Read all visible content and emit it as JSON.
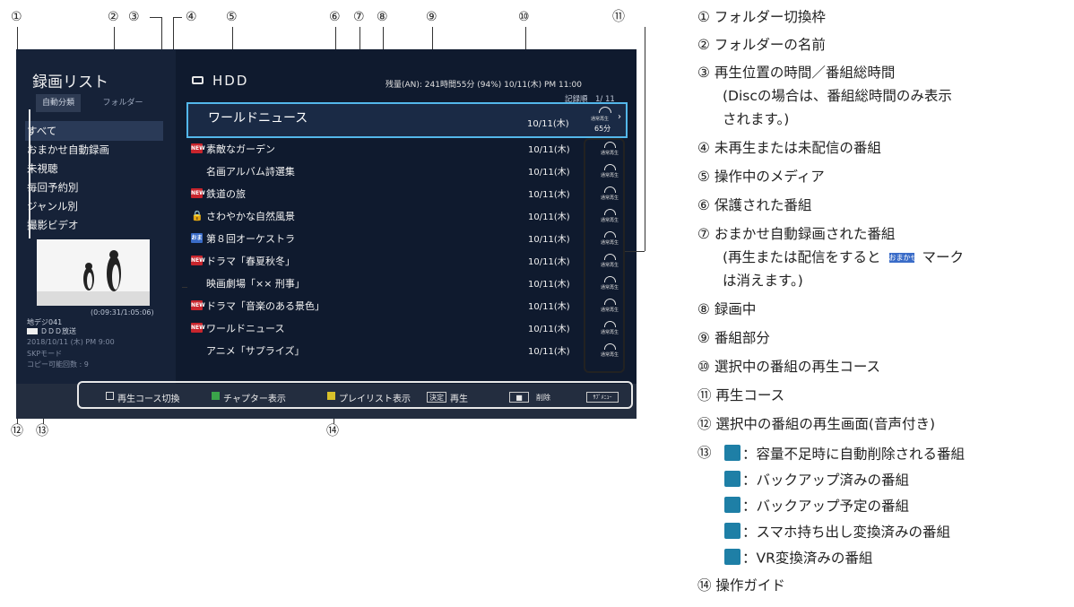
{
  "callouts": [
    "①",
    "②",
    "③",
    "④",
    "⑤",
    "⑥",
    "⑦",
    "⑧",
    "⑨",
    "⑩",
    "⑪",
    "⑫",
    "⑬",
    "⑭"
  ],
  "screen": {
    "left_panel": {
      "title": "録画リスト",
      "tabs": [
        "自動分類",
        "フォルダー"
      ],
      "folders": [
        "すべて",
        "おまかせ自動録画",
        "未視聴",
        "毎回予約別",
        "ジャンル別",
        "撮影ビデオ"
      ],
      "time_code": "(0:09:31/1:05:06)",
      "channel": "地デジ041",
      "broadcaster": "ＤＤＤ放送",
      "air_time": "2018/10/11 (木) PM 9:00",
      "mode": "SKPモード",
      "copy_count": "コピー可能回数 : 9",
      "trash_glyph": "⊞"
    },
    "header": {
      "media": "HDD",
      "remaining": "残量(AN):  241時間55分 (94%)  10/11(木)  PM 11:00",
      "sort": "記録順　1/ 11"
    },
    "selected": {
      "title": "ワールドニュース",
      "date": "10/11(木)",
      "course": "通常再生",
      "minutes": "65分",
      "arrow": "›"
    },
    "programs": [
      {
        "badge": "NEW",
        "title": "素敵なガーデン",
        "date": "10/11(木)",
        "course": "通常再生"
      },
      {
        "badge": "",
        "title": "名画アルバム詩選集",
        "date": "10/11(木)",
        "course": "通常再生"
      },
      {
        "badge": "NEW",
        "title": "鉄道の旅",
        "date": "10/11(木)",
        "course": "通常再生"
      },
      {
        "badge": "🔒",
        "title": "さわやかな自然風景",
        "date": "10/11(木)",
        "course": "通常再生"
      },
      {
        "badge": "おま",
        "title": "第８回オーケストラ",
        "date": "10/11(木)",
        "course": "通常再生"
      },
      {
        "badge": "NEW",
        "title": "ドラマ「春夏秋冬」",
        "date": "10/11(木)",
        "course": "通常再生"
      },
      {
        "badge": "",
        "title": "映画劇場「×× 刑事」",
        "date": "10/11(木)",
        "course": "通常再生"
      },
      {
        "badge": "NEW",
        "title": "ドラマ「音楽のある景色」",
        "date": "10/11(木)",
        "course": "通常再生"
      },
      {
        "badge": "NEW",
        "title": "ワールドニュース",
        "date": "10/11(木)",
        "course": "通常再生"
      },
      {
        "badge": "",
        "title": "アニメ「サプライズ」",
        "date": "10/11(木)",
        "course": "通常再生"
      }
    ],
    "guide": {
      "switch": "再生コース切換",
      "chapter": "チャプター表示",
      "playlist": "プレイリスト表示",
      "enter_key": "決定",
      "play": "再生",
      "delete": "削除",
      "submenu": "ｻﾌﾞﾒﾆｭｰ"
    }
  },
  "legend": {
    "l1": "①  フォルダー切換枠",
    "l2": "②  フォルダーの名前",
    "l3a": "③  再生位置の時間／番組総時間",
    "l3b": "(Discの場合は、番組総時間のみ表示",
    "l3c": "されます。)",
    "l4": "④  未再生または未配信の番組",
    "l5": "⑤  操作中のメディア",
    "l6": "⑥  保護された番組",
    "l7a": "⑦  おまかせ自動録画された番組",
    "l7b_pre": "(再生または配信をすると",
    "l7b_badge": "おまかせ",
    "l7b_post": "マーク",
    "l7c": "は消えます。)",
    "l8": "⑧  録画中",
    "l9": "⑨  番組部分",
    "l10": "⑩  選択中の番組の再生コース",
    "l11": "⑪  再生コース",
    "l12": "⑫  選択中の番組の再生画面(音声付き)",
    "l13": "⑬",
    "l13a": "：容量不足時に自動削除される番組",
    "l13b": "：バックアップ済みの番組",
    "l13c": "：バックアップ予定の番組",
    "l13d": "：スマホ持ち出し変換済みの番組",
    "l13e": "：VR変換済みの番組",
    "l14": "⑭  操作ガイド"
  },
  "colors": {
    "screen_bg": "#0f1a2e",
    "selection": "#53b7ea",
    "new_badge": "#c8252d"
  }
}
